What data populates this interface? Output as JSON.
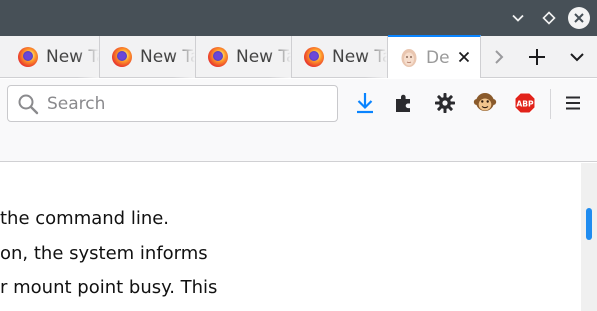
{
  "tabs": [
    {
      "label": "New Tab",
      "icon": "firefox-icon",
      "active": false
    },
    {
      "label": "New Tab",
      "icon": "firefox-icon",
      "active": false
    },
    {
      "label": "New Tab",
      "icon": "firefox-icon",
      "active": false
    },
    {
      "label": "New Tab",
      "icon": "firefox-icon",
      "active": false
    },
    {
      "label": "De",
      "icon": "portrait-favicon",
      "active": true
    }
  ],
  "search": {
    "placeholder": "Search",
    "value": ""
  },
  "toolbar_icons": [
    "download-icon",
    "puzzle-extensions-icon",
    "gear-icon",
    "monkey-extension-icon",
    "adblock-abp-icon",
    "hamburger-menu-icon"
  ],
  "adblock": {
    "label": "ABP"
  },
  "content": {
    "lines": [
      "the command line.",
      "on, the system informs",
      "r mount point busy. This"
    ]
  },
  "colors": {
    "accent": "#0a84ff",
    "titlebar": "#475057",
    "abp": "#e2231a"
  }
}
